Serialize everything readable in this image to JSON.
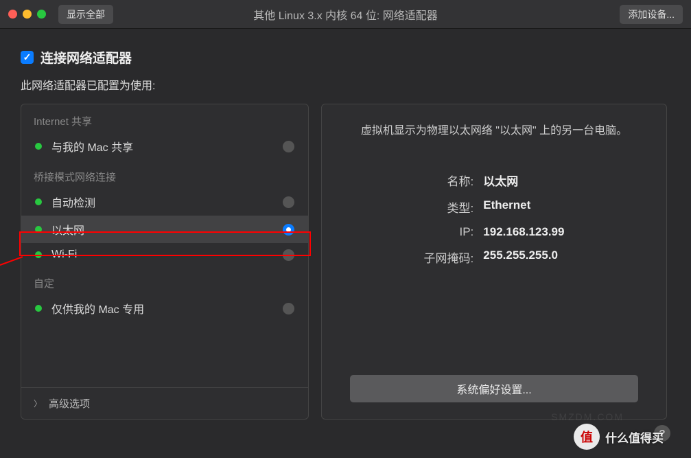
{
  "titlebar": {
    "showAll": "显示全部",
    "title": "其他 Linux 3.x 内核 64 位: 网络适配器",
    "addDevice": "添加设备..."
  },
  "header": {
    "checkboxChecked": true,
    "title": "连接网络适配器",
    "subtitle": "此网络适配器已配置为使用:"
  },
  "leftPanel": {
    "sections": [
      {
        "header": "Internet 共享",
        "items": [
          {
            "label": "与我的 Mac 共享",
            "selected": false
          }
        ]
      },
      {
        "header": "桥接模式网络连接",
        "items": [
          {
            "label": "自动检测",
            "selected": false
          },
          {
            "label": "以太网",
            "selected": true
          },
          {
            "label": "Wi-Fi",
            "selected": false
          }
        ]
      },
      {
        "header": "自定",
        "items": [
          {
            "label": "仅供我的 Mac 专用",
            "selected": false
          }
        ]
      }
    ],
    "advanced": "高级选项"
  },
  "rightPanel": {
    "description": "虚拟机显示为物理以太网络 \"以太网\" 上的另一台电脑。",
    "details": {
      "nameLabel": "名称:",
      "nameValue": "以太网",
      "typeLabel": "类型:",
      "typeValue": "Ethernet",
      "ipLabel": "IP:",
      "ipValue": "192.168.123.99",
      "maskLabel": "子网掩码:",
      "maskValue": "255.255.255.0"
    },
    "sysPrefBtn": "系统偏好设置..."
  },
  "watermark": {
    "circle": "值",
    "text": "什么值得买"
  }
}
